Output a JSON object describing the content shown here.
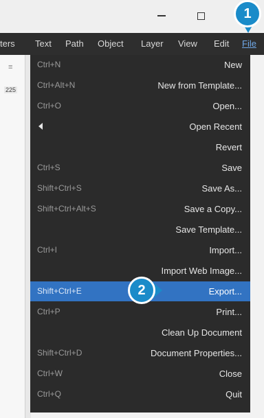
{
  "menubar": {
    "items": [
      "ters",
      "Text",
      "Path",
      "Object",
      "Layer",
      "View",
      "Edit",
      "File"
    ],
    "active": "File"
  },
  "ruler": {
    "number": "225"
  },
  "menu": {
    "items": [
      {
        "shortcut": "Ctrl+N",
        "label": "New"
      },
      {
        "shortcut": "Ctrl+Alt+N",
        "label": "New from Template..."
      },
      {
        "shortcut": "Ctrl+O",
        "label": "Open..."
      },
      {
        "shortcut": "",
        "label": "Open Recent",
        "submenu": true
      },
      {
        "shortcut": "",
        "label": "Revert"
      },
      {
        "shortcut": "Ctrl+S",
        "label": "Save"
      },
      {
        "shortcut": "Shift+Ctrl+S",
        "label": "Save As..."
      },
      {
        "shortcut": "Shift+Ctrl+Alt+S",
        "label": "Save a Copy..."
      },
      {
        "shortcut": "",
        "label": "Save Template..."
      },
      {
        "shortcut": "Ctrl+I",
        "label": "Import..."
      },
      {
        "shortcut": "",
        "label": "Import Web Image..."
      },
      {
        "shortcut": "Shift+Ctrl+E",
        "label": "Export...",
        "highlighted": true
      },
      {
        "shortcut": "Ctrl+P",
        "label": "Print..."
      },
      {
        "shortcut": "",
        "label": "Clean Up Document"
      },
      {
        "shortcut": "Shift+Ctrl+D",
        "label": "Document Properties..."
      },
      {
        "shortcut": "Ctrl+W",
        "label": "Close"
      },
      {
        "shortcut": "Ctrl+Q",
        "label": "Quit"
      }
    ]
  },
  "callouts": {
    "step1": "1",
    "step2": "2"
  },
  "colors": {
    "menu_bg": "#2b2b2b",
    "highlight": "#3273c2",
    "badge": "#1a8bc9"
  }
}
